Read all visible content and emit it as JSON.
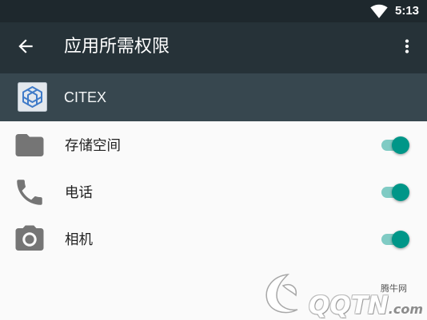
{
  "status_bar": {
    "time": "5:13",
    "wifi_icon": "wifi-icon"
  },
  "toolbar": {
    "title": "应用所需权限",
    "back_icon": "arrow-back-icon",
    "menu_icon": "more-vert-icon"
  },
  "app": {
    "name": "CITEX",
    "icon": "app-logo"
  },
  "permissions": [
    {
      "label": "存储空间",
      "icon": "folder-icon",
      "checked": true
    },
    {
      "label": "电话",
      "icon": "phone-icon",
      "checked": true
    },
    {
      "label": "相机",
      "icon": "camera-icon",
      "checked": true
    }
  ],
  "watermark": {
    "site_name": "腾牛网",
    "brand": "QQTN",
    "suffix": ".com"
  },
  "colors": {
    "status_bar": "#1e282d",
    "toolbar": "#263238",
    "app_header": "#37474f",
    "background": "#fafafa",
    "text": "#212121",
    "icon": "#757575",
    "accent": "#009688",
    "accent_track": "#80cbc4"
  }
}
